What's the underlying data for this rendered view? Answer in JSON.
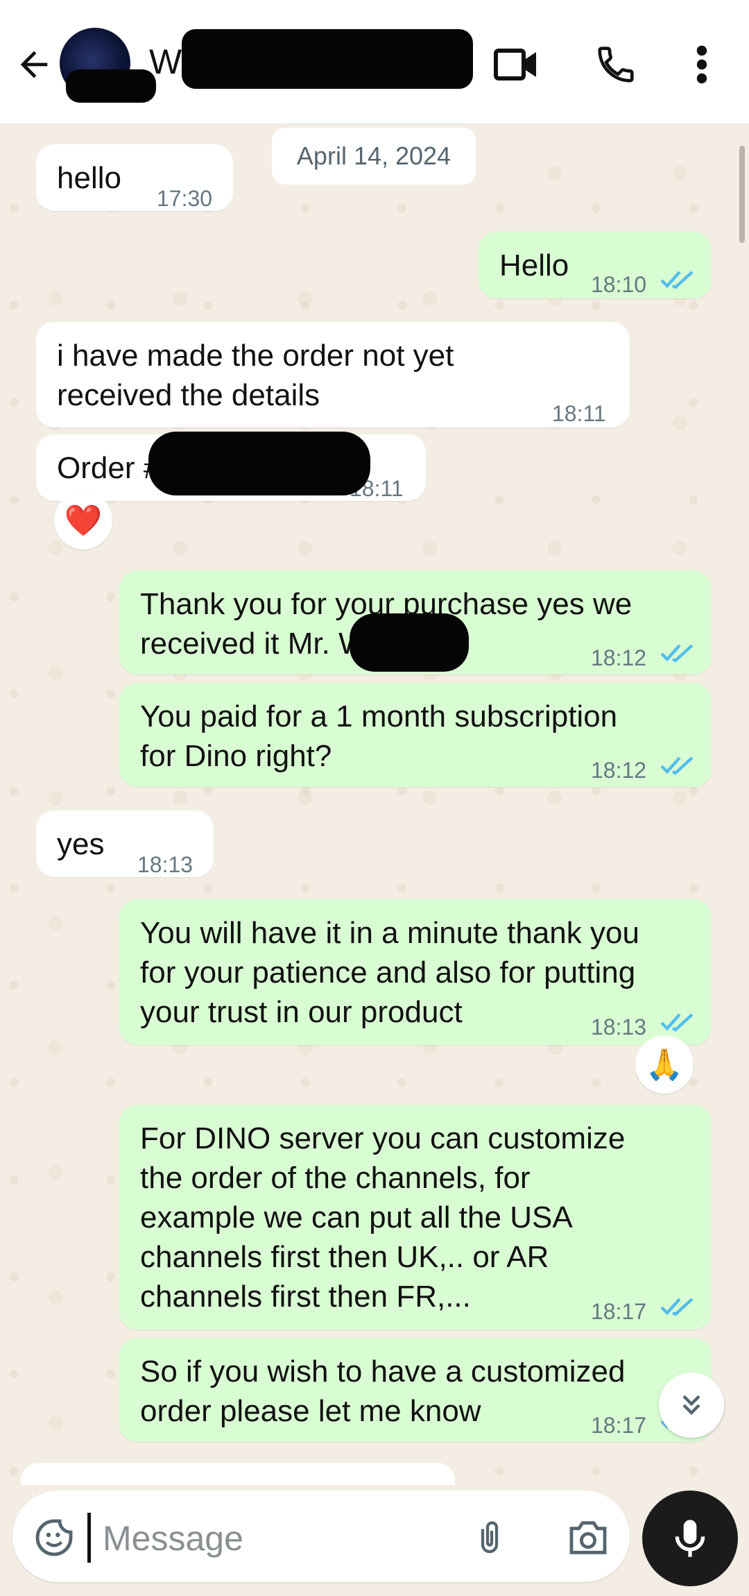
{
  "header": {
    "title": "Wal",
    "icons": {
      "back": "arrow-left-icon",
      "video": "video-call-icon",
      "phone": "phone-icon",
      "menu": "more-vert-icon"
    }
  },
  "chat": {
    "date": "April 14, 2024",
    "messages": [
      {
        "dir": "in",
        "text": "hello",
        "time": "17:30"
      },
      {
        "dir": "out",
        "text": "Hello",
        "time": "18:10",
        "status": "read"
      },
      {
        "dir": "in",
        "text": "i have made the order not yet\nreceived the details",
        "time": "18:11"
      },
      {
        "dir": "in",
        "text": "Order #",
        "time": "18:11",
        "reaction": "❤️"
      },
      {
        "dir": "out",
        "text": "Thank you for your purchase yes we\nreceived it Mr. W",
        "time": "18:12",
        "status": "read"
      },
      {
        "dir": "out",
        "text": "You paid for a 1 month subscription\nfor Dino right?",
        "time": "18:12",
        "status": "read"
      },
      {
        "dir": "in",
        "text": "yes",
        "time": "18:13"
      },
      {
        "dir": "out",
        "text": "You will have it in a minute thank you\nfor your patience and also for putting\nyour trust in our product",
        "time": "18:13",
        "status": "read",
        "reaction": "🙏"
      },
      {
        "dir": "out",
        "text": "For DINO server you can customize\nthe order of the channels, for\nexample we can put all the USA\nchannels first then UK,.. or AR\nchannels first then FR,...",
        "time": "18:17",
        "status": "read"
      },
      {
        "dir": "out",
        "text": "So if you wish to have a customized\norder please let me know",
        "time": "18:17",
        "status": "read"
      }
    ]
  },
  "composer": {
    "placeholder": "Message",
    "icons": {
      "emoji": "sticker-icon",
      "attach": "paperclip-icon",
      "camera": "camera-icon",
      "mic": "mic-icon",
      "scroll": "double-chevron-down-icon"
    }
  },
  "colors": {
    "outgoing": "#d9fdd3",
    "incoming": "#ffffff",
    "tick": "#53bdeb",
    "background": "#f3ede4"
  }
}
